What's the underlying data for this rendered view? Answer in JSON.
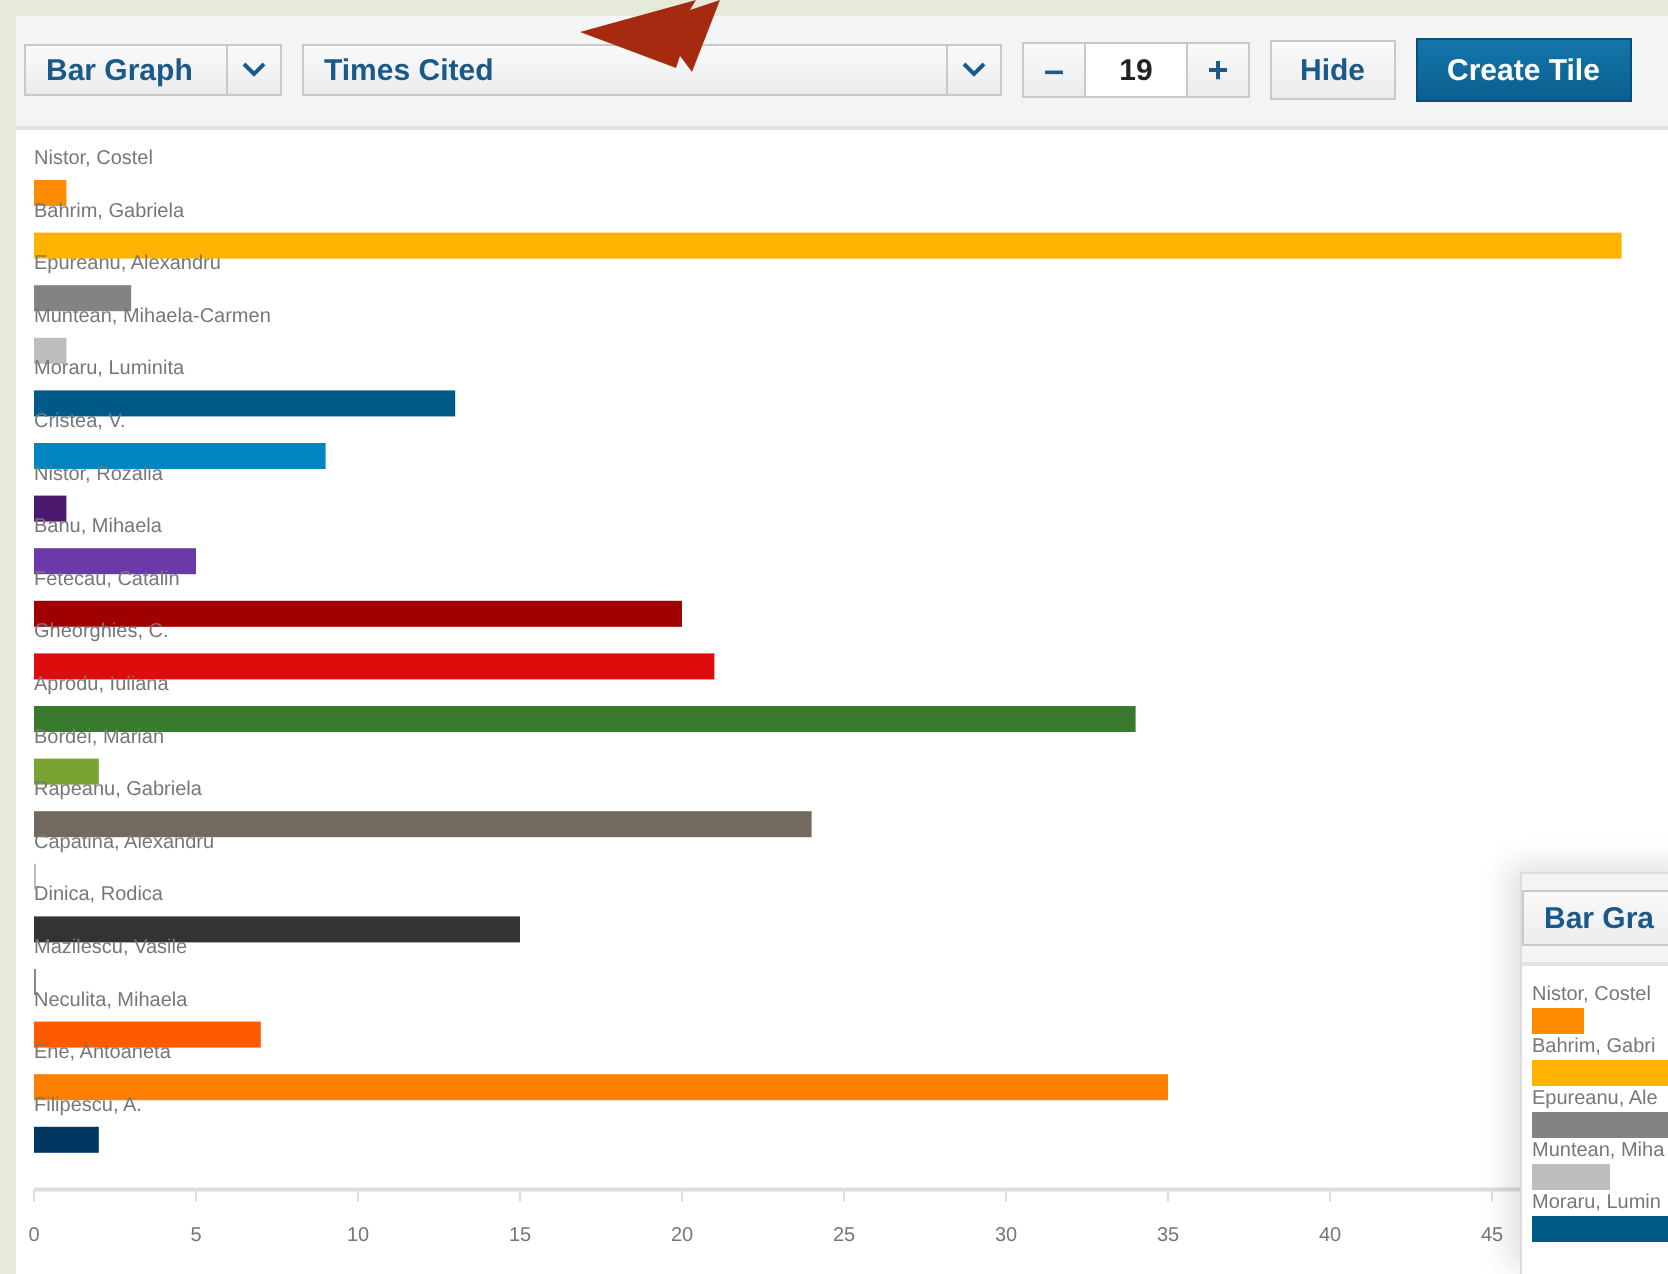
{
  "toolbar": {
    "chart_type": "Bar Graph",
    "metric": "Times Cited",
    "decrement": "–",
    "count": "19",
    "increment": "+",
    "hide": "Hide",
    "create": "Create Tile"
  },
  "chart": {
    "chart_data": {
      "type": "bar",
      "orientation": "horizontal",
      "categories": [
        "Nistor, Costel",
        "Bahrim, Gabriela",
        "Epureanu, Alexandru",
        "Muntean, Mihaela-Carmen",
        "Moraru, Luminita",
        "Cristea, V.",
        "Nistor, Rozalia",
        "Banu, Mihaela",
        "Fetecau, Catalin",
        "Gheorghies, C.",
        "Aprodu, Iuliana",
        "Bordei, Marian",
        "Rapeanu, Gabriela",
        "Capatina, Alexandru",
        "Dinica, Rodica",
        "Mazilescu, Vasile",
        "Neculita, Mihaela",
        "Ene, Antoaneta",
        "Filipescu, A."
      ],
      "colors": [
        "#ff8c00",
        "#ffb300",
        "#838383",
        "#bdbdbd",
        "#005a87",
        "#0085c3",
        "#4b1a6e",
        "#6b3aa8",
        "#a00000",
        "#de0c0c",
        "#3a7a2e",
        "#79a332",
        "#726a60",
        "#bdbdbd",
        "#333333",
        "#888888",
        "#ff5a00",
        "#ff8000",
        "#003660"
      ],
      "values": [
        1,
        49,
        3,
        1,
        13,
        9,
        1,
        5,
        20,
        21,
        34,
        2,
        24,
        0,
        15,
        0,
        7,
        35,
        2
      ],
      "xlim": [
        0,
        50
      ],
      "xticks": [
        0,
        5,
        10,
        15,
        20,
        25,
        30,
        35,
        40,
        45
      ]
    }
  },
  "inset": {
    "chart_type": "Bar Gra",
    "rows": [
      {
        "label": "Nistor, Costel",
        "color": "#ff8c00"
      },
      {
        "label": "Bahrim, Gabri",
        "color": "#ffb300"
      },
      {
        "label": "Epureanu, Ale",
        "color": "#838383"
      },
      {
        "label": "Muntean, Miha",
        "color": "#bdbdbd"
      },
      {
        "label": "Moraru, Lumin",
        "color": "#005a87"
      }
    ]
  }
}
